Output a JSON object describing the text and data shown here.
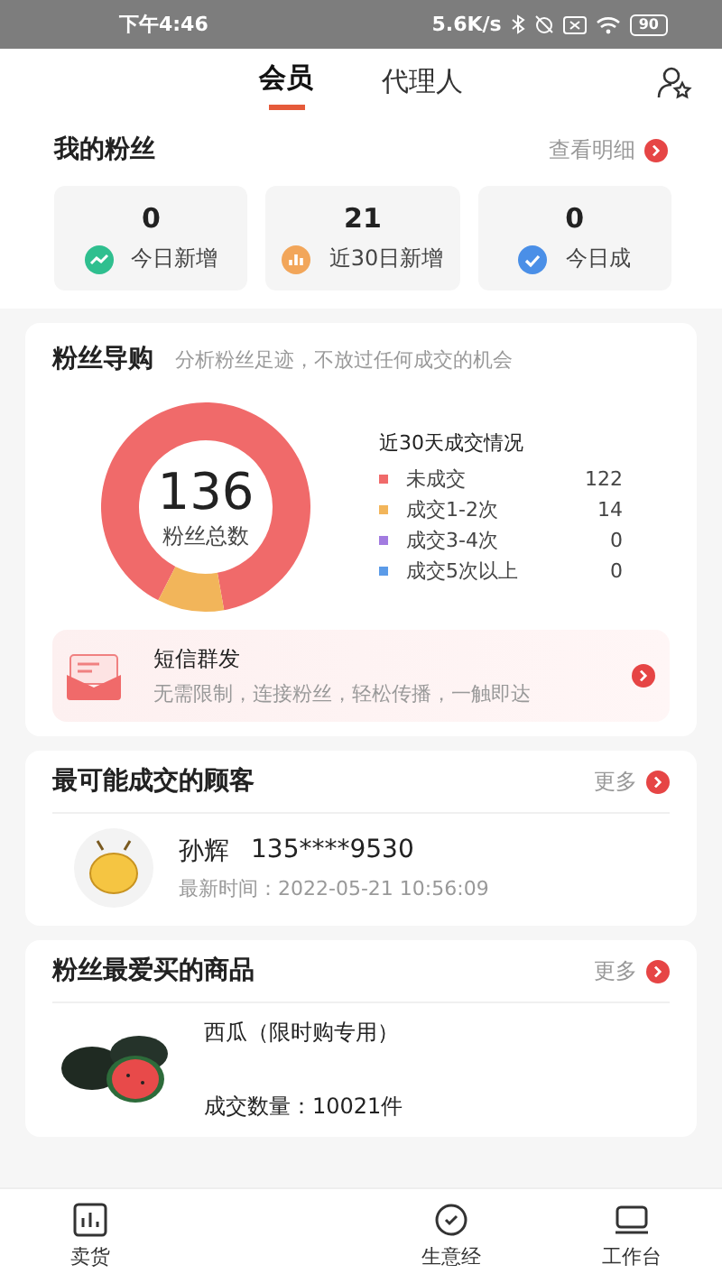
{
  "status_bar": {
    "time": "下午4:46",
    "speed": "5.6K/s",
    "battery": "90"
  },
  "tabs": [
    {
      "label": "会员",
      "selected": true
    },
    {
      "label": "代理人",
      "selected": false
    }
  ],
  "fans": {
    "title": "我的粉丝",
    "link": "查看明细",
    "stats": [
      {
        "value": "0",
        "label": "今日新增",
        "kind": "trend",
        "color": "#2fbf8f"
      },
      {
        "value": "21",
        "label": "近30日新增",
        "kind": "bars",
        "color": "#f2a65a"
      },
      {
        "value": "0",
        "label": "今日成",
        "kind": "check",
        "color": "#4a8fe7"
      }
    ]
  },
  "guide": {
    "title": "粉丝导购",
    "subtitle": "分析粉丝足迹，不放过任何成交的机会",
    "total": "136",
    "total_label": "粉丝总数",
    "legend_title": "近30天成交情况",
    "legend": [
      {
        "label": "未成交",
        "value": "122",
        "color": "#f06a6a"
      },
      {
        "label": "成交1-2次",
        "value": "14",
        "color": "#f2b55a"
      },
      {
        "label": "成交3-4次",
        "value": "0",
        "color": "#a27be0"
      },
      {
        "label": "成交5次以上",
        "value": "0",
        "color": "#5b9be8"
      }
    ],
    "sms": {
      "title": "短信群发",
      "desc": "无需限制，连接粉丝，轻松传播，一触即达"
    }
  },
  "customers": {
    "title": "最可能成交的顾客",
    "link": "更多",
    "items": [
      {
        "name": "孙辉",
        "phone": "135****9530",
        "time": "最新时间：2022-05-21 10:56:09"
      }
    ]
  },
  "products": {
    "title": "粉丝最爱买的商品",
    "link": "更多",
    "items": [
      {
        "name": "西瓜（限时购专用）",
        "sales": "成交数量：10021件",
        "kind": "picture"
      }
    ]
  },
  "nav": [
    {
      "label": "卖货",
      "kind": "chart"
    },
    {
      "label": "生意经",
      "kind": "circle"
    },
    {
      "label": "工作台",
      "kind": "desk"
    }
  ]
}
